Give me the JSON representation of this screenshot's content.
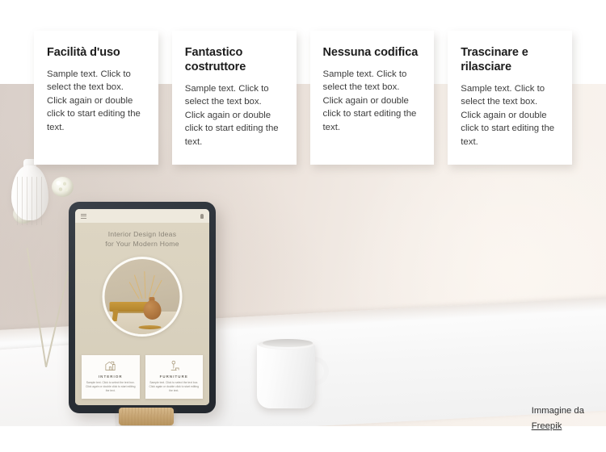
{
  "feature_cards": [
    {
      "title": "Facilità d'uso",
      "text": "Sample text. Click to select the text box. Click again or double click to start editing the text."
    },
    {
      "title": "Fantastico costruttore",
      "text": "Sample text. Click to select the text box. Click again or double click to start editing the text."
    },
    {
      "title": "Nessuna codifica",
      "text": "Sample text. Click to select the text box. Click again or double click to start editing the text."
    },
    {
      "title": "Trascinare e rilasciare",
      "text": "Sample text. Click to select the text box. Click again or double click to start editing the text."
    }
  ],
  "tablet": {
    "menu_icon": "hamburger-icon",
    "bell_icon": "bell-icon",
    "headline_line1": "Interior Design Ideas",
    "headline_line2": "for Your Modern Home",
    "cards": [
      {
        "icon": "house-interior-icon",
        "title": "INTERIOR",
        "text": "Sample text. Click to select the text box. Click again or double click to start editing the text."
      },
      {
        "icon": "lamp-furniture-icon",
        "title": "FURNITURE",
        "text": "Sample text. Click to select the text box. Click again or double click to start editing the text."
      }
    ]
  },
  "credit": {
    "prefix": "Immagine da",
    "link": "Freepik"
  },
  "colors": {
    "card_background": "#ffffff",
    "wall_left": "#d9cfc9",
    "wall_right": "#f8f3ee",
    "desk": "#fbfbfb",
    "tablet_frame": "#2b3138",
    "tablet_screen": "#d9d1be",
    "title_text": "#1c1c1c",
    "body_text": "#3d3d3d"
  }
}
